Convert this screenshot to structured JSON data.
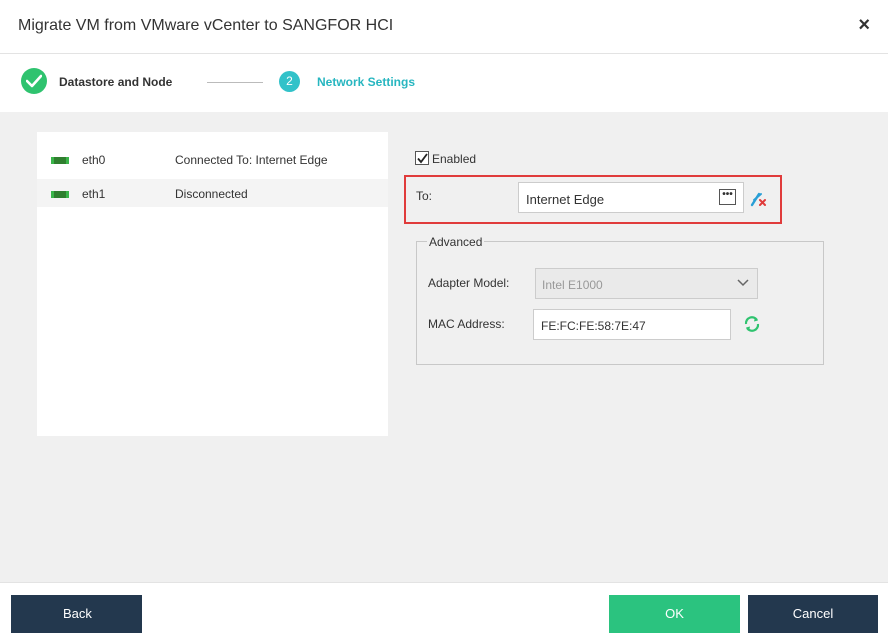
{
  "dialog": {
    "title": "Migrate VM from VMware vCenter to SANGFOR HCI",
    "close_label": "×"
  },
  "steps": [
    {
      "label": "Datastore and Node",
      "state": "complete"
    },
    {
      "number": "2",
      "label": "Network Settings",
      "state": "active"
    }
  ],
  "nics": [
    {
      "name": "eth0",
      "status": "Connected To: Internet Edge"
    },
    {
      "name": "eth1",
      "status": "Disconnected"
    }
  ],
  "settings": {
    "enabled_label": "Enabled",
    "enabled": true,
    "to_label": "To:",
    "to_value": "Internet Edge",
    "ellipsis": "•••",
    "advanced": {
      "legend": "Advanced",
      "adapter_model_label": "Adapter Model:",
      "adapter_model_value": "Intel E1000",
      "mac_label": "MAC Address:",
      "mac_value": "FE:FC:FE:58:7E:47"
    }
  },
  "footer": {
    "back_label": "Back",
    "ok_label": "OK",
    "cancel_label": "Cancel"
  },
  "colors": {
    "primary_dark": "#23384e",
    "ok_green": "#2bc37f",
    "step_active": "#32c2c9",
    "step_done": "#2fc36f",
    "highlight": "#e03b3b"
  }
}
